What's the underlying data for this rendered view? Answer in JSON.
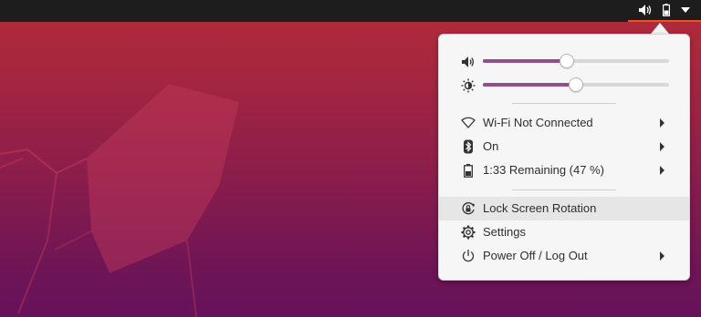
{
  "topbar": {
    "tray_icons": [
      "speaker-icon",
      "battery-icon",
      "dropdown-triangle-icon"
    ]
  },
  "colors": {
    "accent": "#e95420",
    "slider_fill": "#924d8b",
    "menu_bg": "#f6f6f6",
    "topbar_bg": "#1d1d1d"
  },
  "menu": {
    "volume": {
      "icon": "speaker-icon",
      "level": 0.45
    },
    "brightness": {
      "icon": "brightness-icon",
      "level": 0.5
    },
    "items": [
      {
        "icon": "wifi-icon",
        "label": "Wi-Fi Not Connected",
        "submenu": true
      },
      {
        "icon": "bluetooth-icon",
        "label": "On",
        "submenu": true
      },
      {
        "icon": "battery-icon",
        "label": "1:33 Remaining (47 %)",
        "submenu": true
      },
      {
        "icon": "rotation-lock-icon",
        "label": "Lock Screen Rotation",
        "submenu": false,
        "highlighted": true
      },
      {
        "icon": "settings-icon",
        "label": "Settings",
        "submenu": false
      },
      {
        "icon": "power-icon",
        "label": "Power Off / Log Out",
        "submenu": true
      }
    ]
  }
}
